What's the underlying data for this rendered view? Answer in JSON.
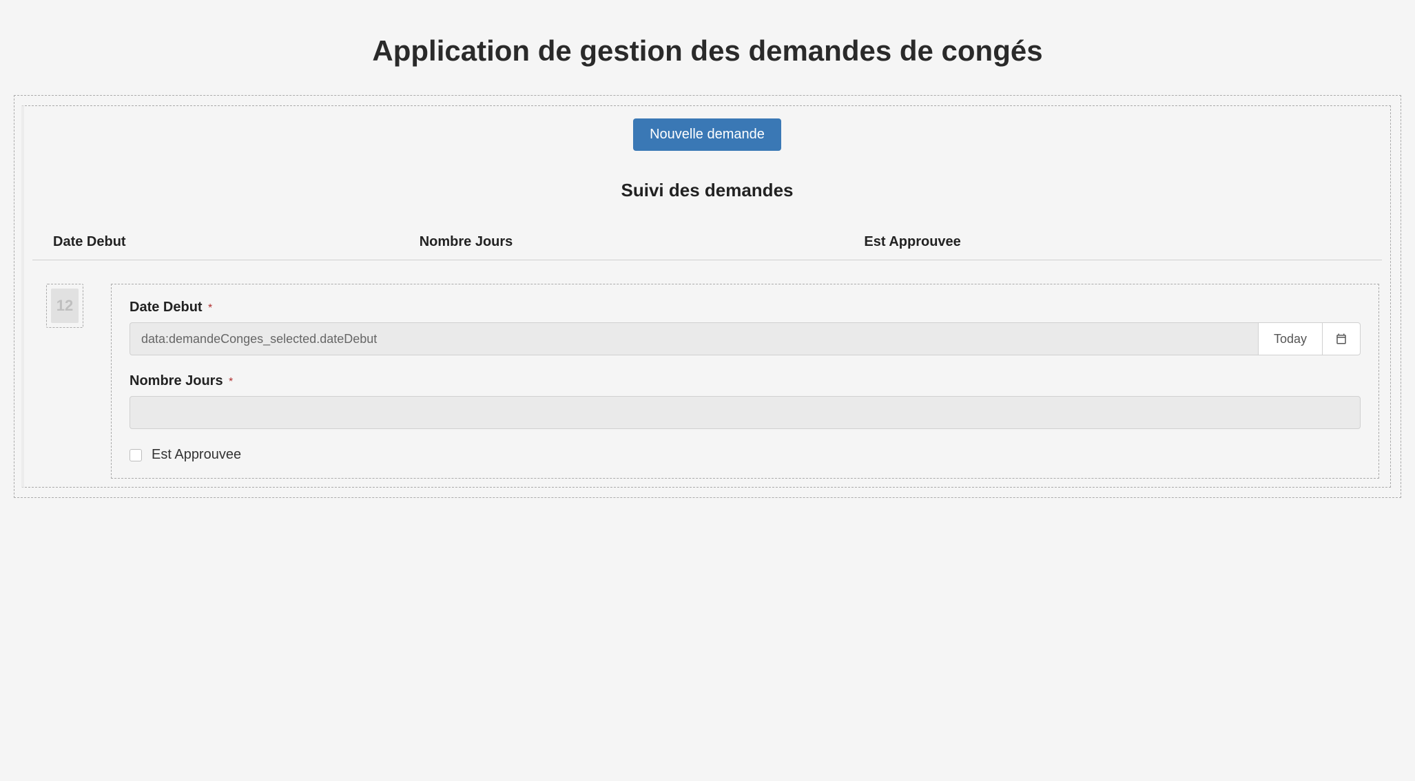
{
  "page_title": "Application de gestion des demandes de congés",
  "actions": {
    "new_request_label": "Nouvelle demande"
  },
  "section": {
    "tracking_heading": "Suivi des demandes"
  },
  "table": {
    "headers": {
      "date_debut": "Date Debut",
      "nombre_jours": "Nombre Jours",
      "est_approuvee": "Est Approuvee"
    }
  },
  "day_badge": {
    "day_number": "12"
  },
  "form": {
    "date_debut": {
      "label": "Date Debut",
      "required_mark": "*",
      "value": "data:demandeConges_selected.dateDebut",
      "today_label": "Today"
    },
    "nombre_jours": {
      "label": "Nombre Jours",
      "required_mark": "*",
      "value": ""
    },
    "est_approuvee": {
      "label": "Est Approuvee",
      "checked": false
    }
  }
}
